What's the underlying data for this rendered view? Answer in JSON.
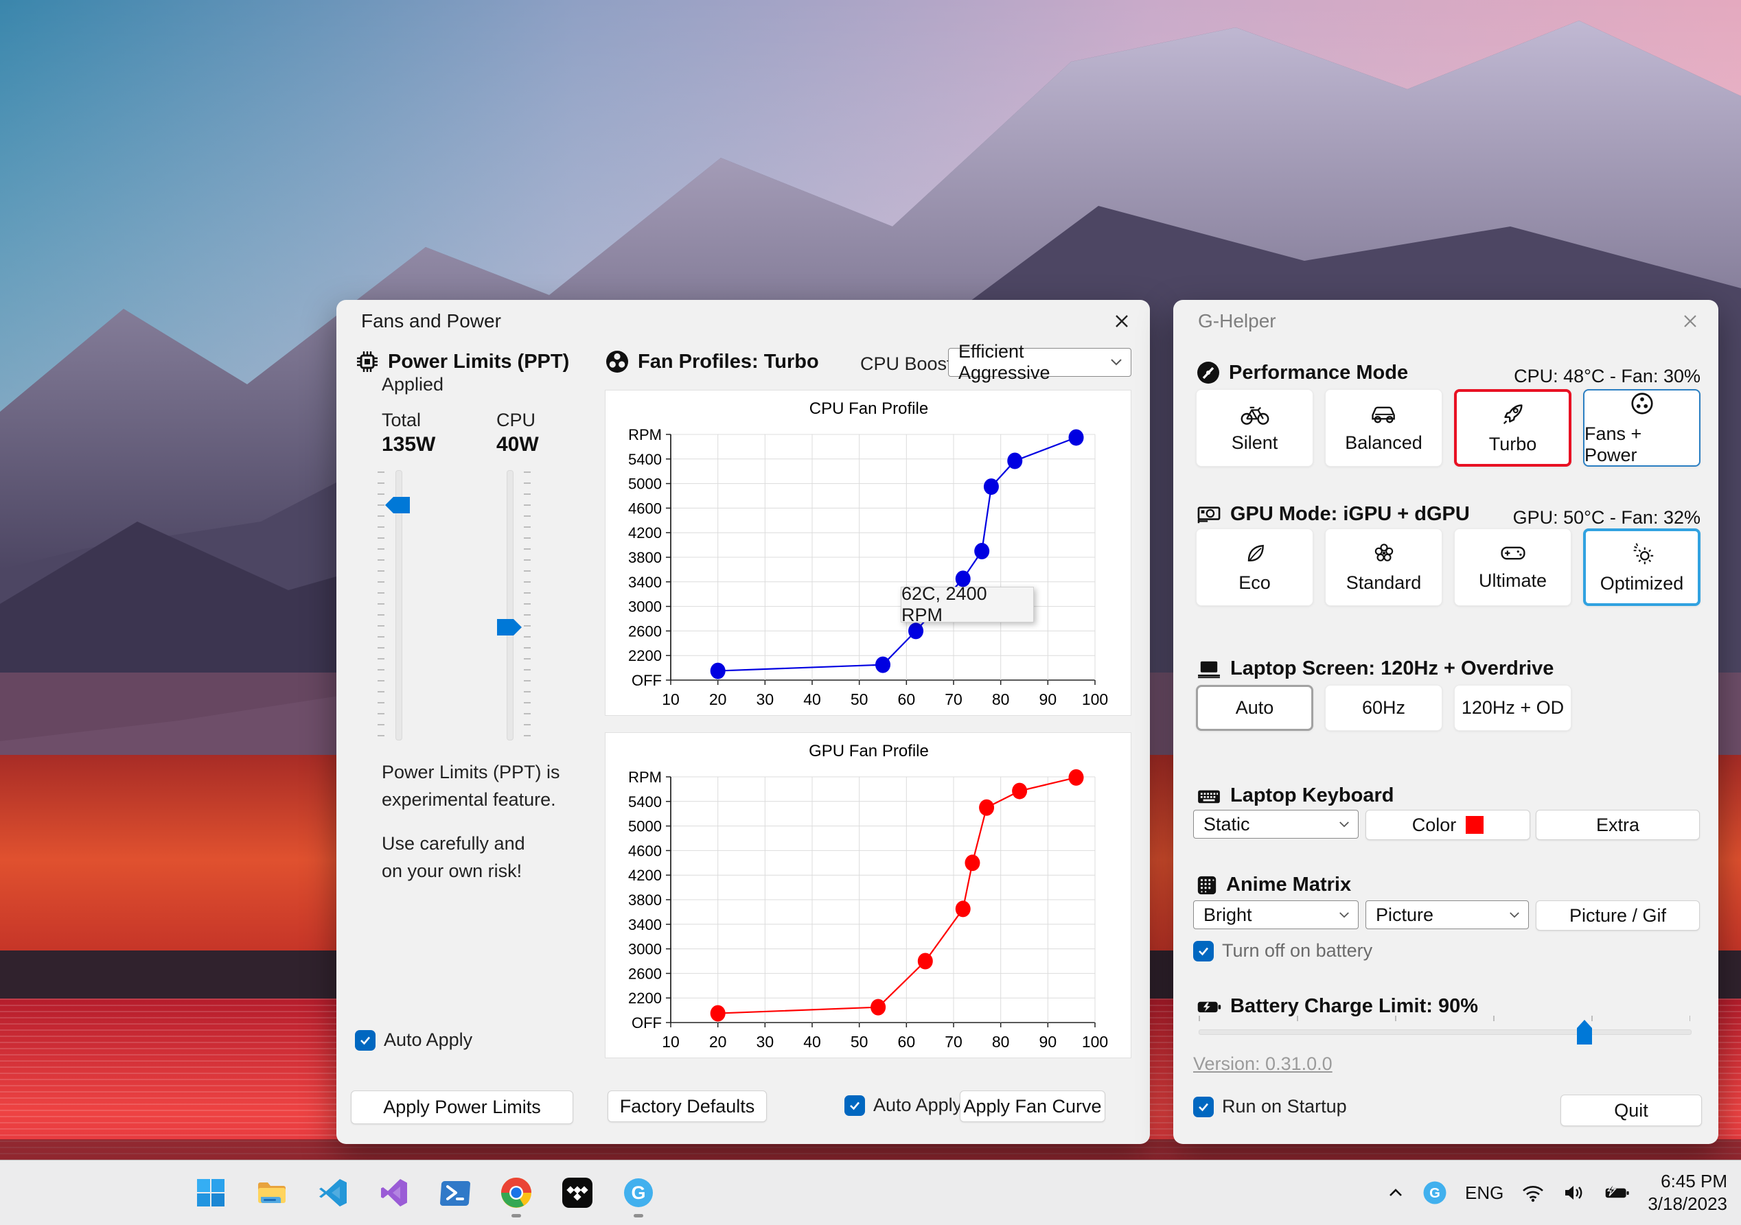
{
  "colors": {
    "selected_red_border": "#e81123",
    "selected_blue_border": "#31a2e0",
    "fans_power_border": "#2b7fc2",
    "checkbox_blue": "#0067c0",
    "slider_blue": "#0078d7",
    "link_blue": "#0000ee",
    "cpu_series": "#0000e1",
    "gpu_series": "#ff0000",
    "keyboard_swatch": "#ff0000"
  },
  "left_window": {
    "title": "Fans and Power",
    "power": {
      "header": "Power Limits (PPT)",
      "status_link": "Applied",
      "total_label": "Total",
      "total_value": "135W",
      "cpu_label": "CPU",
      "cpu_value": "40W",
      "warning_1": "Power Limits (PPT) is\nexperimental feature.",
      "warning_2": "Use carefully and\non your own risk!",
      "auto_apply_label": "Auto Apply",
      "auto_apply_checked": true,
      "apply_button": "Apply Power Limits"
    },
    "fans": {
      "header": "Fan Profiles: Turbo",
      "cpu_boost_label": "CPU Boost",
      "cpu_boost_value": "Efficient Aggressive",
      "factory_defaults_button": "Factory Defaults",
      "auto_apply_label": "Auto Apply",
      "auto_apply_checked": true,
      "apply_fan_curve_button": "Apply Fan Curve"
    }
  },
  "chart_data": [
    {
      "type": "line",
      "title": "CPU Fan Profile",
      "series_color": "#0000e1",
      "x": [
        20,
        55,
        62,
        72,
        76,
        78,
        83,
        96
      ],
      "y": [
        1950,
        2050,
        2600,
        3450,
        3900,
        4950,
        5370,
        5750
      ],
      "x_ticks": [
        10,
        20,
        30,
        40,
        50,
        60,
        70,
        80,
        90,
        100
      ],
      "y_tick_labels_top_to_bottom": [
        "RPM",
        "5400",
        "5000",
        "4600",
        "4200",
        "3800",
        "3400",
        "3000",
        "2600",
        "2200",
        "OFF"
      ],
      "y_value_range": [
        1800,
        5800
      ],
      "grid": true,
      "legend": "none",
      "tooltip": "62C, 2400 RPM"
    },
    {
      "type": "line",
      "title": "GPU Fan Profile",
      "series_color": "#ff0000",
      "x": [
        20,
        54,
        64,
        72,
        74,
        77,
        84,
        96
      ],
      "y": [
        1950,
        2050,
        2800,
        3650,
        4400,
        5300,
        5570,
        5790
      ],
      "x_ticks": [
        10,
        20,
        30,
        40,
        50,
        60,
        70,
        80,
        90,
        100
      ],
      "y_tick_labels_top_to_bottom": [
        "RPM",
        "5400",
        "5000",
        "4600",
        "4200",
        "3800",
        "3400",
        "3000",
        "2600",
        "2200",
        "OFF"
      ],
      "y_value_range": [
        1800,
        5800
      ],
      "grid": true,
      "legend": "none",
      "tooltip": ""
    }
  ],
  "right_window": {
    "title": "G-Helper",
    "performance": {
      "header": "Performance Mode",
      "status": "CPU: 48°C -  Fan: 30%",
      "buttons": [
        {
          "label": "Silent",
          "icon": "bicycle-icon",
          "selected": false
        },
        {
          "label": "Balanced",
          "icon": "car-icon",
          "selected": false
        },
        {
          "label": "Turbo",
          "icon": "rocket-icon",
          "selected": true
        },
        {
          "label": "Fans + Power",
          "icon": "fan-icon",
          "selected": false
        }
      ]
    },
    "gpu": {
      "header": "GPU Mode: iGPU + dGPU",
      "status": "GPU: 50°C -  Fan: 32%",
      "buttons": [
        {
          "label": "Eco",
          "icon": "leaf-icon",
          "selected": false
        },
        {
          "label": "Standard",
          "icon": "flower-icon",
          "selected": false
        },
        {
          "label": "Ultimate",
          "icon": "gamepad-icon",
          "selected": false
        },
        {
          "label": "Optimized",
          "icon": "gear-sparkle-icon",
          "selected": true
        }
      ]
    },
    "screen": {
      "header": "Laptop Screen: 120Hz + Overdrive",
      "buttons": [
        {
          "label": "Auto",
          "selected": true
        },
        {
          "label": "60Hz",
          "selected": false
        },
        {
          "label": "120Hz + OD",
          "selected": false
        }
      ]
    },
    "keyboard": {
      "header": "Laptop Keyboard",
      "mode_value": "Static",
      "color_button": "Color",
      "extra_button": "Extra"
    },
    "anime": {
      "header": "Anime Matrix",
      "brightness_value": "Bright",
      "content_value": "Picture",
      "picture_gif_button": "Picture / Gif",
      "turn_off_label": "Turn off on battery",
      "turn_off_checked": true
    },
    "battery": {
      "header": "Battery Charge Limit: 90%",
      "percent": 90
    },
    "version_link": "Version: 0.31.0.0",
    "run_on_startup_label": "Run on Startup",
    "run_on_startup_checked": true,
    "quit_button": "Quit"
  },
  "taskbar": {
    "apps": [
      "windows-start",
      "file-explorer",
      "vscode",
      "visual-studio",
      "powershell",
      "chrome",
      "tidal",
      "g-helper"
    ],
    "running_apps": [
      "chrome",
      "g-helper"
    ],
    "g_logo_letter": "G",
    "tray": {
      "language": "ENG",
      "time": "6:45 PM",
      "date": "3/18/2023"
    }
  }
}
